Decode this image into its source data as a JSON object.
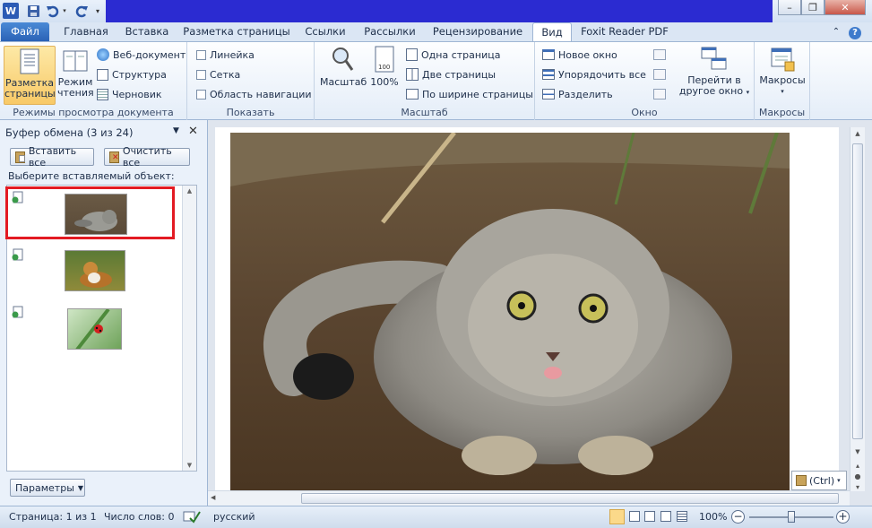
{
  "qat": {
    "word_icon": "word-icon",
    "save_icon": "save-icon",
    "undo_icon": "undo-icon",
    "redo_icon": "redo-icon"
  },
  "window_buttons": {
    "minimize": "–",
    "restore": "❐",
    "close": "✕"
  },
  "tabs": [
    {
      "label": "Файл"
    },
    {
      "label": "Главная"
    },
    {
      "label": "Вставка"
    },
    {
      "label": "Разметка страницы"
    },
    {
      "label": "Ссылки"
    },
    {
      "label": "Рассылки"
    },
    {
      "label": "Рецензирование"
    },
    {
      "label": "Вид"
    },
    {
      "label": "Foxit Reader PDF"
    }
  ],
  "ribbon": {
    "views": {
      "print_layout": [
        "Разметка",
        "страницы"
      ],
      "reading": [
        "Режим",
        "чтения"
      ],
      "web": "Веб-документ",
      "outline": "Структура",
      "draft": "Черновик",
      "group_label": "Режимы просмотра документа"
    },
    "show": {
      "ruler": "Линейка",
      "grid": "Сетка",
      "nav_pane": "Область навигации",
      "group_label": "Показать"
    },
    "zoom": {
      "zoom": "Масштаб",
      "hundred": "100%",
      "one_page": "Одна страница",
      "two_pages": "Две страницы",
      "page_width": "По ширине страницы",
      "group_label": "Масштаб"
    },
    "window": {
      "new_window": "Новое окно",
      "arrange_all": "Упорядочить все",
      "split": "Разделить",
      "switch": [
        "Перейти в",
        "другое окно"
      ],
      "group_label": "Окно"
    },
    "macros": {
      "macros": "Макросы",
      "group_label": "Макросы"
    }
  },
  "clipboard": {
    "title": "Буфер обмена (3 из 24)",
    "paste_all": "Вставить все",
    "clear_all": "Очистить все",
    "prompt": "Выберите вставляемый объект:",
    "options": "Параметры"
  },
  "paste_options": "(Ctrl)",
  "status": {
    "page": "Страница: 1 из 1",
    "words": "Число слов: 0",
    "language": "русский",
    "zoom": "100%",
    "zoom_level": 0.5
  },
  "colors": {
    "accent": "#2b579a",
    "file_tab": "#2a62b6",
    "highlight": "#e31b23"
  }
}
